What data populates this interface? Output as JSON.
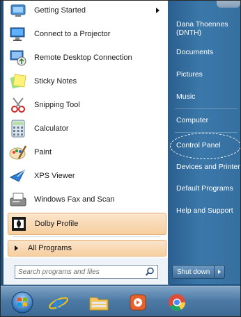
{
  "left_menu": {
    "items": [
      {
        "label": "Getting Started",
        "icon": "getting-started-icon",
        "has_submenu": true
      },
      {
        "label": "Connect to a Projector",
        "icon": "projector-icon"
      },
      {
        "label": "Remote Desktop Connection",
        "icon": "remote-desktop-icon"
      },
      {
        "label": "Sticky Notes",
        "icon": "sticky-notes-icon"
      },
      {
        "label": "Snipping Tool",
        "icon": "snipping-tool-icon"
      },
      {
        "label": "Calculator",
        "icon": "calculator-icon"
      },
      {
        "label": "Paint",
        "icon": "paint-icon"
      },
      {
        "label": "XPS Viewer",
        "icon": "xps-viewer-icon"
      },
      {
        "label": "Windows Fax and Scan",
        "icon": "fax-scan-icon"
      },
      {
        "label": "Dolby Profile",
        "icon": "dolby-icon",
        "highlighted": true
      }
    ],
    "all_programs": "All Programs"
  },
  "search": {
    "placeholder": "Search programs and files",
    "icon": "search-icon"
  },
  "right_menu": {
    "user": "Dana Thoennes (DNTH)",
    "items": [
      "Documents",
      "Pictures",
      "Music",
      "Computer",
      "Control Panel",
      "Devices and Printers",
      "Default Programs",
      "Help and Support"
    ],
    "circled_item": "Control Panel"
  },
  "shutdown": {
    "label": "Shut down"
  },
  "taskbar": {
    "items": [
      "start-orb-icon",
      "internet-explorer-icon",
      "file-explorer-icon",
      "media-player-icon",
      "chrome-icon"
    ]
  },
  "colors": {
    "highlight": "#f7cf9f",
    "right_pane": "#3b78aa",
    "taskbar": "#4c7aa5"
  }
}
